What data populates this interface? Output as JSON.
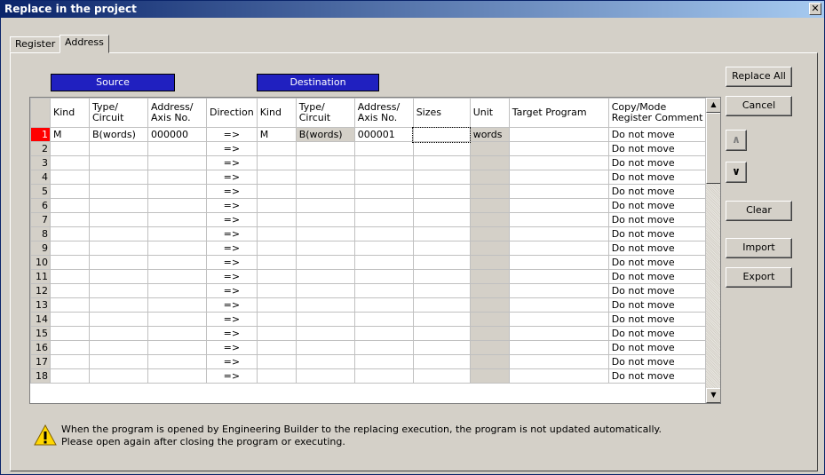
{
  "window": {
    "title": "Replace in the project",
    "close_label": "✕"
  },
  "tabs": [
    {
      "label": "Register"
    },
    {
      "label": "Address"
    }
  ],
  "headers": {
    "source": "Source",
    "destination": "Destination"
  },
  "columns": [
    "Kind",
    "Type/\nCircuit",
    "Address/\nAxis No.",
    "Direction",
    "Kind",
    "Type/\nCircuit",
    "Address/\nAxis No.",
    "Sizes",
    "Unit",
    "Target Program",
    "Copy/Mode\nRegister Comment"
  ],
  "rows": [
    {
      "num": "1",
      "src_kind": "M",
      "src_type": "B(words)",
      "src_addr": "000000",
      "dir": "=>",
      "dst_kind": "M",
      "dst_type": "B(words)",
      "dst_addr": "000001",
      "sizes": "",
      "unit": "words",
      "target": "",
      "mode": "Do not move"
    },
    {
      "num": "2",
      "src_kind": "",
      "src_type": "",
      "src_addr": "",
      "dir": "=>",
      "dst_kind": "",
      "dst_type": "",
      "dst_addr": "",
      "sizes": "",
      "unit": "",
      "target": "",
      "mode": "Do not move"
    },
    {
      "num": "3",
      "src_kind": "",
      "src_type": "",
      "src_addr": "",
      "dir": "=>",
      "dst_kind": "",
      "dst_type": "",
      "dst_addr": "",
      "sizes": "",
      "unit": "",
      "target": "",
      "mode": "Do not move"
    },
    {
      "num": "4",
      "src_kind": "",
      "src_type": "",
      "src_addr": "",
      "dir": "=>",
      "dst_kind": "",
      "dst_type": "",
      "dst_addr": "",
      "sizes": "",
      "unit": "",
      "target": "",
      "mode": "Do not move"
    },
    {
      "num": "5",
      "src_kind": "",
      "src_type": "",
      "src_addr": "",
      "dir": "=>",
      "dst_kind": "",
      "dst_type": "",
      "dst_addr": "",
      "sizes": "",
      "unit": "",
      "target": "",
      "mode": "Do not move"
    },
    {
      "num": "6",
      "src_kind": "",
      "src_type": "",
      "src_addr": "",
      "dir": "=>",
      "dst_kind": "",
      "dst_type": "",
      "dst_addr": "",
      "sizes": "",
      "unit": "",
      "target": "",
      "mode": "Do not move"
    },
    {
      "num": "7",
      "src_kind": "",
      "src_type": "",
      "src_addr": "",
      "dir": "=>",
      "dst_kind": "",
      "dst_type": "",
      "dst_addr": "",
      "sizes": "",
      "unit": "",
      "target": "",
      "mode": "Do not move"
    },
    {
      "num": "8",
      "src_kind": "",
      "src_type": "",
      "src_addr": "",
      "dir": "=>",
      "dst_kind": "",
      "dst_type": "",
      "dst_addr": "",
      "sizes": "",
      "unit": "",
      "target": "",
      "mode": "Do not move"
    },
    {
      "num": "9",
      "src_kind": "",
      "src_type": "",
      "src_addr": "",
      "dir": "=>",
      "dst_kind": "",
      "dst_type": "",
      "dst_addr": "",
      "sizes": "",
      "unit": "",
      "target": "",
      "mode": "Do not move"
    },
    {
      "num": "10",
      "src_kind": "",
      "src_type": "",
      "src_addr": "",
      "dir": "=>",
      "dst_kind": "",
      "dst_type": "",
      "dst_addr": "",
      "sizes": "",
      "unit": "",
      "target": "",
      "mode": "Do not move"
    },
    {
      "num": "11",
      "src_kind": "",
      "src_type": "",
      "src_addr": "",
      "dir": "=>",
      "dst_kind": "",
      "dst_type": "",
      "dst_addr": "",
      "sizes": "",
      "unit": "",
      "target": "",
      "mode": "Do not move"
    },
    {
      "num": "12",
      "src_kind": "",
      "src_type": "",
      "src_addr": "",
      "dir": "=>",
      "dst_kind": "",
      "dst_type": "",
      "dst_addr": "",
      "sizes": "",
      "unit": "",
      "target": "",
      "mode": "Do not move"
    },
    {
      "num": "13",
      "src_kind": "",
      "src_type": "",
      "src_addr": "",
      "dir": "=>",
      "dst_kind": "",
      "dst_type": "",
      "dst_addr": "",
      "sizes": "",
      "unit": "",
      "target": "",
      "mode": "Do not move"
    },
    {
      "num": "14",
      "src_kind": "",
      "src_type": "",
      "src_addr": "",
      "dir": "=>",
      "dst_kind": "",
      "dst_type": "",
      "dst_addr": "",
      "sizes": "",
      "unit": "",
      "target": "",
      "mode": "Do not move"
    },
    {
      "num": "15",
      "src_kind": "",
      "src_type": "",
      "src_addr": "",
      "dir": "=>",
      "dst_kind": "",
      "dst_type": "",
      "dst_addr": "",
      "sizes": "",
      "unit": "",
      "target": "",
      "mode": "Do not move"
    },
    {
      "num": "16",
      "src_kind": "",
      "src_type": "",
      "src_addr": "",
      "dir": "=>",
      "dst_kind": "",
      "dst_type": "",
      "dst_addr": "",
      "sizes": "",
      "unit": "",
      "target": "",
      "mode": "Do not move"
    },
    {
      "num": "17",
      "src_kind": "",
      "src_type": "",
      "src_addr": "",
      "dir": "=>",
      "dst_kind": "",
      "dst_type": "",
      "dst_addr": "",
      "sizes": "",
      "unit": "",
      "target": "",
      "mode": "Do not move"
    },
    {
      "num": "18",
      "src_kind": "",
      "src_type": "",
      "src_addr": "",
      "dir": "=>",
      "dst_kind": "",
      "dst_type": "",
      "dst_addr": "",
      "sizes": "",
      "unit": "",
      "target": "",
      "mode": "Do not move"
    }
  ],
  "buttons": {
    "replace_all": "Replace All",
    "cancel": "Cancel",
    "move_up": "∧",
    "move_down": "∨",
    "clear": "Clear",
    "import": "Import",
    "export": "Export"
  },
  "note": {
    "line1": "When the program is opened by Engineering Builder to the replacing execution, the program is not updated automatically.",
    "line2": "Please open again after closing the program or executing.",
    "icon": "warning-icon"
  },
  "colors": {
    "selected_row": "#ff0000",
    "header_blue": "#2020c0",
    "titlebar": "#0a246a"
  }
}
